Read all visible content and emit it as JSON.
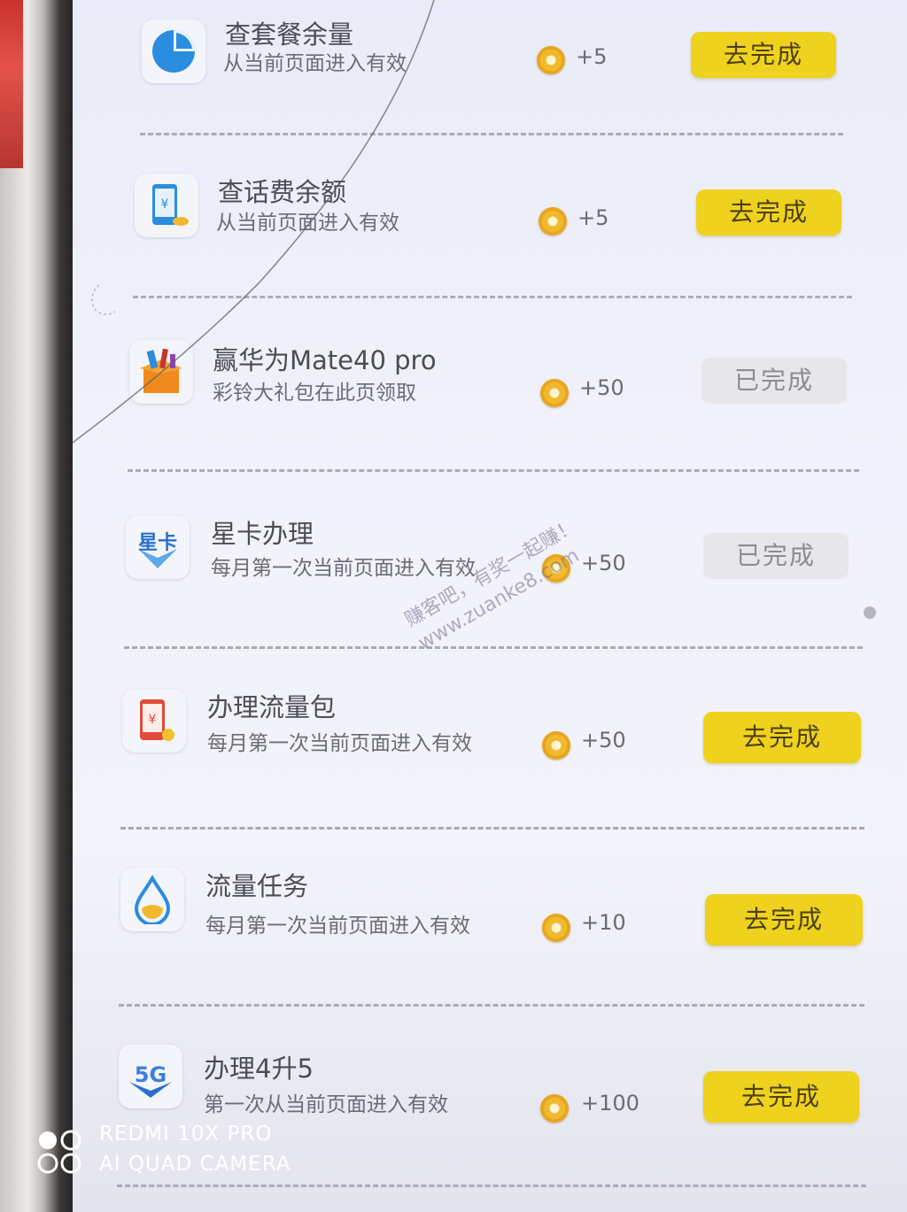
{
  "tasks": [
    {
      "icon": "pie-chart-icon",
      "title": "查套餐余量",
      "desc": "从当前页面进入有效",
      "points": "+5",
      "status": "去完成",
      "done": false
    },
    {
      "icon": "phone-balance-icon",
      "title": "查话费余额",
      "desc": "从当前页面进入有效",
      "points": "+5",
      "status": "去完成",
      "done": false
    },
    {
      "icon": "gift-box-icon",
      "title": "赢华为Mate40 pro",
      "desc": "彩铃大礼包在此页领取",
      "points": "+50",
      "status": "已完成",
      "done": true
    },
    {
      "icon": "star-card-icon",
      "title": "星卡办理",
      "desc": "每月第一次当前页面进入有效",
      "points": "+50",
      "status": "已完成",
      "done": true
    },
    {
      "icon": "data-pack-icon",
      "title": "办理流量包",
      "desc": "每月第一次当前页面进入有效",
      "points": "+50",
      "status": "去完成",
      "done": false
    },
    {
      "icon": "water-drop-icon",
      "title": "流量任务",
      "desc": "每月第一次当前页面进入有效",
      "points": "+10",
      "status": "去完成",
      "done": false
    },
    {
      "icon": "5g-upgrade-icon",
      "title": "办理4升5",
      "desc": "第一次从当前页面进入有效",
      "points": "+100",
      "status": "去完成",
      "done": false
    }
  ],
  "watermark": {
    "line1": "赚客吧，有奖一起赚！",
    "line2": "www.zuanke8.com"
  },
  "camera": {
    "model": "REDMI 10X PRO",
    "label": "AI QUAD CAMERA"
  },
  "icon_texts": {
    "star_card": "星卡",
    "five_g": "5G"
  }
}
